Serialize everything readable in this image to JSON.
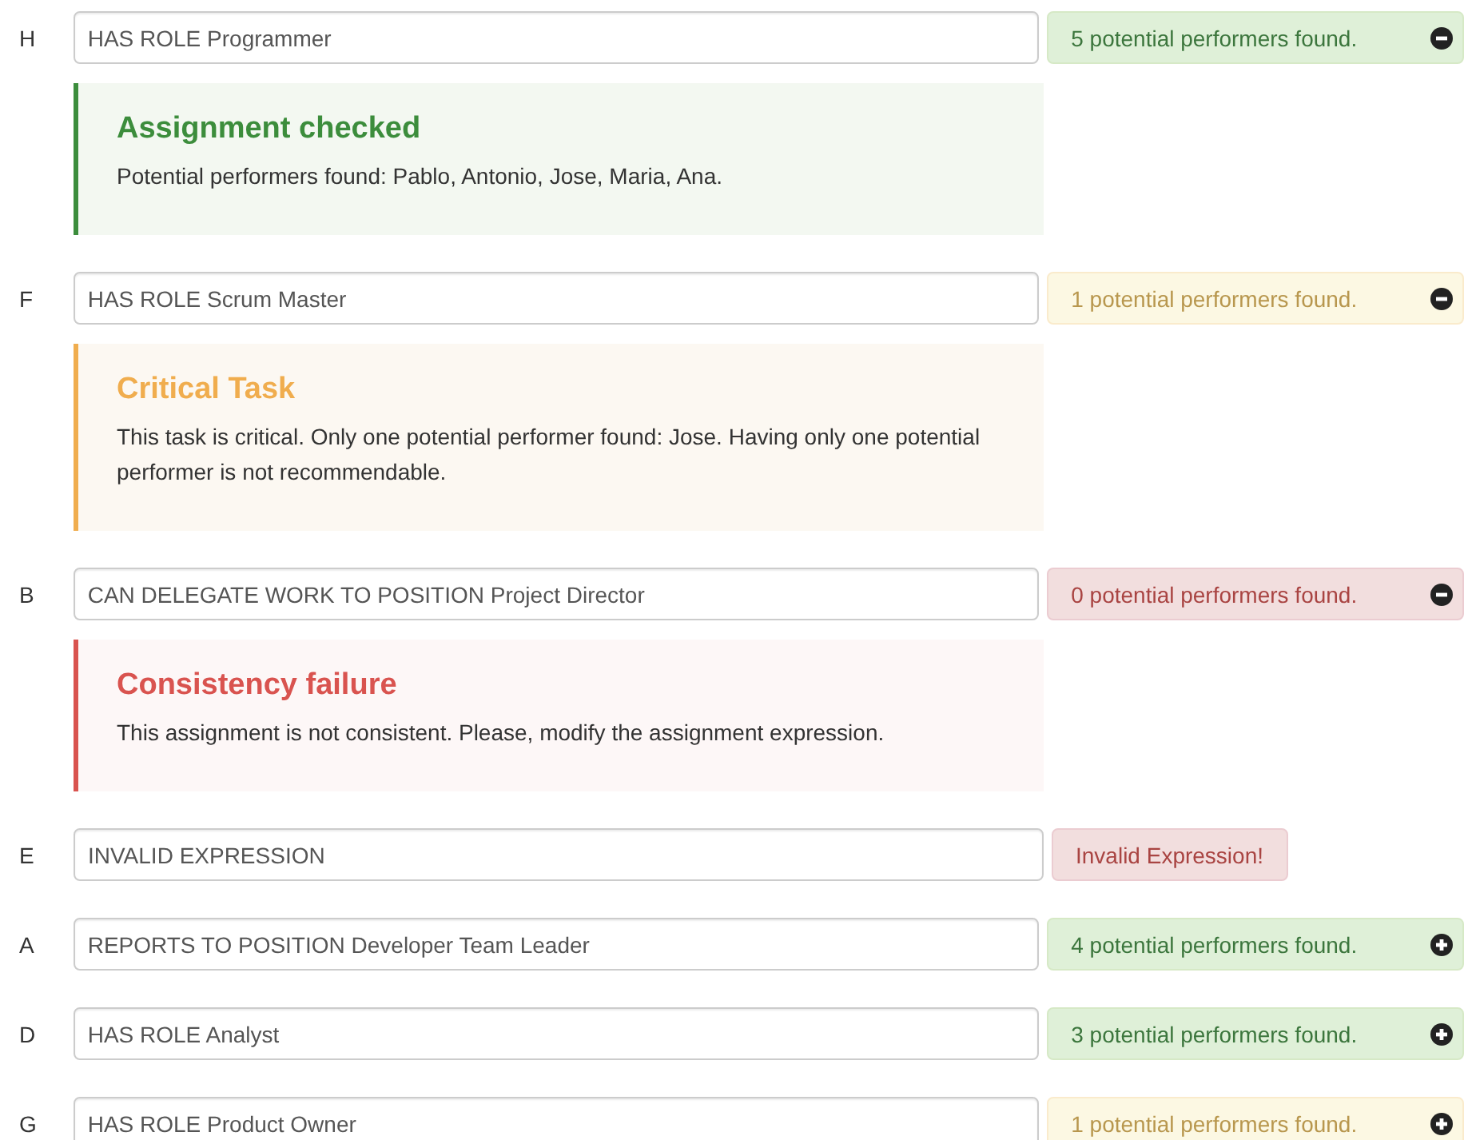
{
  "assignments": [
    {
      "letter": "H",
      "expression": "HAS ROLE Programmer",
      "status": {
        "kind": "success",
        "text": "5 potential performers found."
      },
      "expanded": true,
      "callout": {
        "kind": "success",
        "title": "Assignment checked",
        "body": "Potential performers found: Pablo, Antonio, Jose, Maria, Ana."
      }
    },
    {
      "letter": "F",
      "expression": "HAS ROLE Scrum Master",
      "status": {
        "kind": "warning",
        "text": "1 potential performers found."
      },
      "expanded": true,
      "callout": {
        "kind": "warning",
        "title": "Critical Task",
        "body": "This task is critical. Only one potential performer found: Jose. Having only one potential performer is not recommendable."
      }
    },
    {
      "letter": "B",
      "expression": "CAN DELEGATE WORK TO POSITION Project Director",
      "status": {
        "kind": "danger",
        "text": "0 potential performers found."
      },
      "expanded": true,
      "callout": {
        "kind": "danger",
        "title": "Consistency failure",
        "body": "This assignment is not consistent. Please, modify the assignment expression."
      }
    },
    {
      "letter": "E",
      "expression": "INVALID EXPRESSION",
      "status": {
        "kind": "error",
        "text": "Invalid Expression!"
      }
    },
    {
      "letter": "A",
      "expression": "REPORTS TO POSITION Developer Team Leader",
      "status": {
        "kind": "success",
        "text": "4 potential performers found."
      },
      "expanded": false
    },
    {
      "letter": "D",
      "expression": "HAS ROLE Analyst",
      "status": {
        "kind": "success",
        "text": "3 potential performers found."
      },
      "expanded": false
    },
    {
      "letter": "G",
      "expression": "HAS ROLE Product Owner",
      "status": {
        "kind": "warning",
        "text": "1 potential performers found."
      },
      "expanded": false
    }
  ]
}
